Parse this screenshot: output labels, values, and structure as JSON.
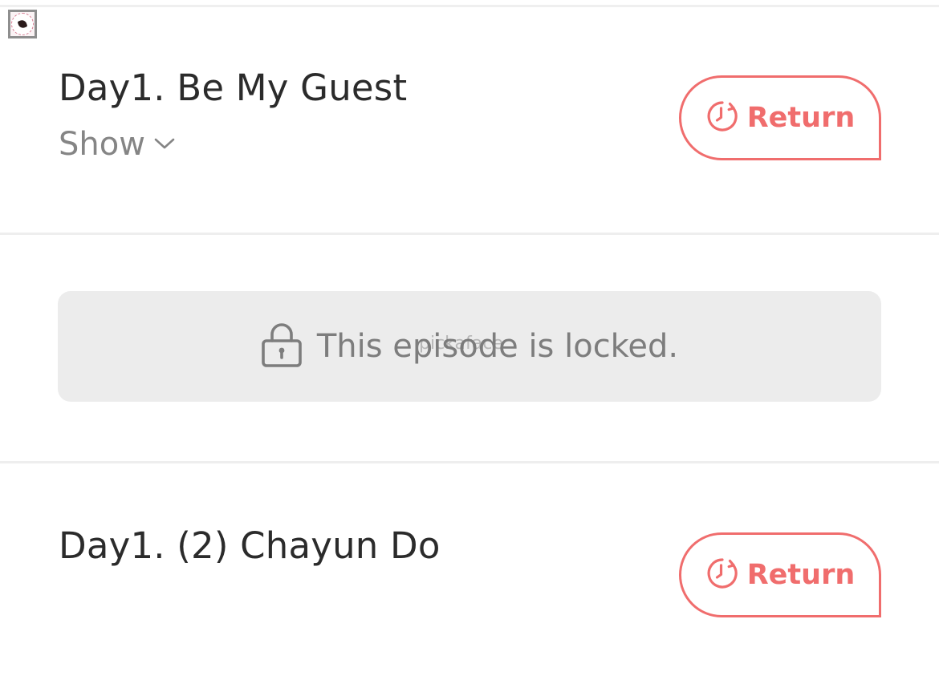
{
  "colors": {
    "accent": "#f06d6d",
    "title_text": "#2b2b2b",
    "muted_text": "#858585",
    "locked_bg": "#ececec",
    "divider": "#eeeeee"
  },
  "episodes": [
    {
      "title": "Day1. Be My Guest",
      "toggle_label": "Show",
      "toggle_icon": "chevron-down-icon",
      "return_label": "Return",
      "return_icon": "clock-return-icon"
    },
    {
      "title": "Day1. (2) Chayun Do",
      "return_label": "Return",
      "return_icon": "clock-return-icon"
    }
  ],
  "locked": {
    "icon": "lock-icon",
    "message": "This episode is locked."
  },
  "watermark": "pickaface"
}
